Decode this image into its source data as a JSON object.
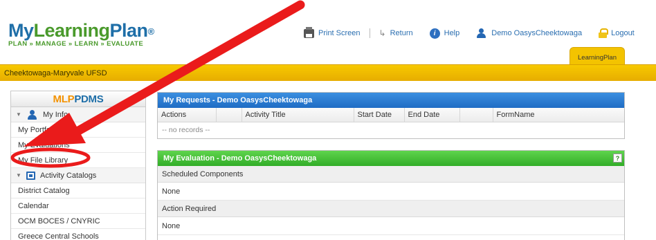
{
  "logo": {
    "part_my": "My",
    "part_learning": "Learning",
    "part_plan": "Plan",
    "registered": "®",
    "tagline": "PLAN » MANAGE » LEARN » EVALUATE"
  },
  "topnav": {
    "print": "Print Screen",
    "return": "Return",
    "help": "Help",
    "user": "Demo OasysCheektowaga",
    "logout": "Logout"
  },
  "active_tab": "LearningPlan",
  "org_name": "Cheektowaga-Maryvale UFSD",
  "sidebar": {
    "brand_mlp": "MLP",
    "brand_pdms": "PDMS",
    "sections": [
      {
        "label": "My Info",
        "items": [
          "My Portfolio",
          "My Evaluations",
          "My File Library"
        ]
      },
      {
        "label": "Activity Catalogs",
        "items": [
          "District Catalog",
          "Calendar",
          "OCM BOCES / CNYRIC",
          "Greece Central Schools"
        ]
      }
    ]
  },
  "requests_panel": {
    "title": "My Requests - Demo OasysCheektowaga",
    "columns": [
      "Actions",
      "",
      "Activity Title",
      "Start Date",
      "End Date",
      "",
      "FormName"
    ],
    "empty_text": "-- no records --"
  },
  "evaluation_panel": {
    "title": "My Evaluation - Demo OasysCheektowaga",
    "help_glyph": "?",
    "sections": [
      {
        "header": "Scheduled Components",
        "value": "None"
      },
      {
        "header": "Action Required",
        "value": "None"
      }
    ]
  },
  "colors": {
    "brand_blue": "#1f6fa8",
    "brand_green": "#4a9a2c",
    "org_bar": "#f3c300",
    "requests_header": "#2a7ad2",
    "evaluation_header": "#44c236",
    "annotation_red": "#ea1b1b"
  },
  "icons": {
    "print": "printer-icon",
    "return": "return-arrow-icon",
    "help": "help-circle-icon",
    "user": "user-icon",
    "logout": "lock-icon",
    "my_info": "user-icon",
    "catalogs": "catalog-icon"
  }
}
